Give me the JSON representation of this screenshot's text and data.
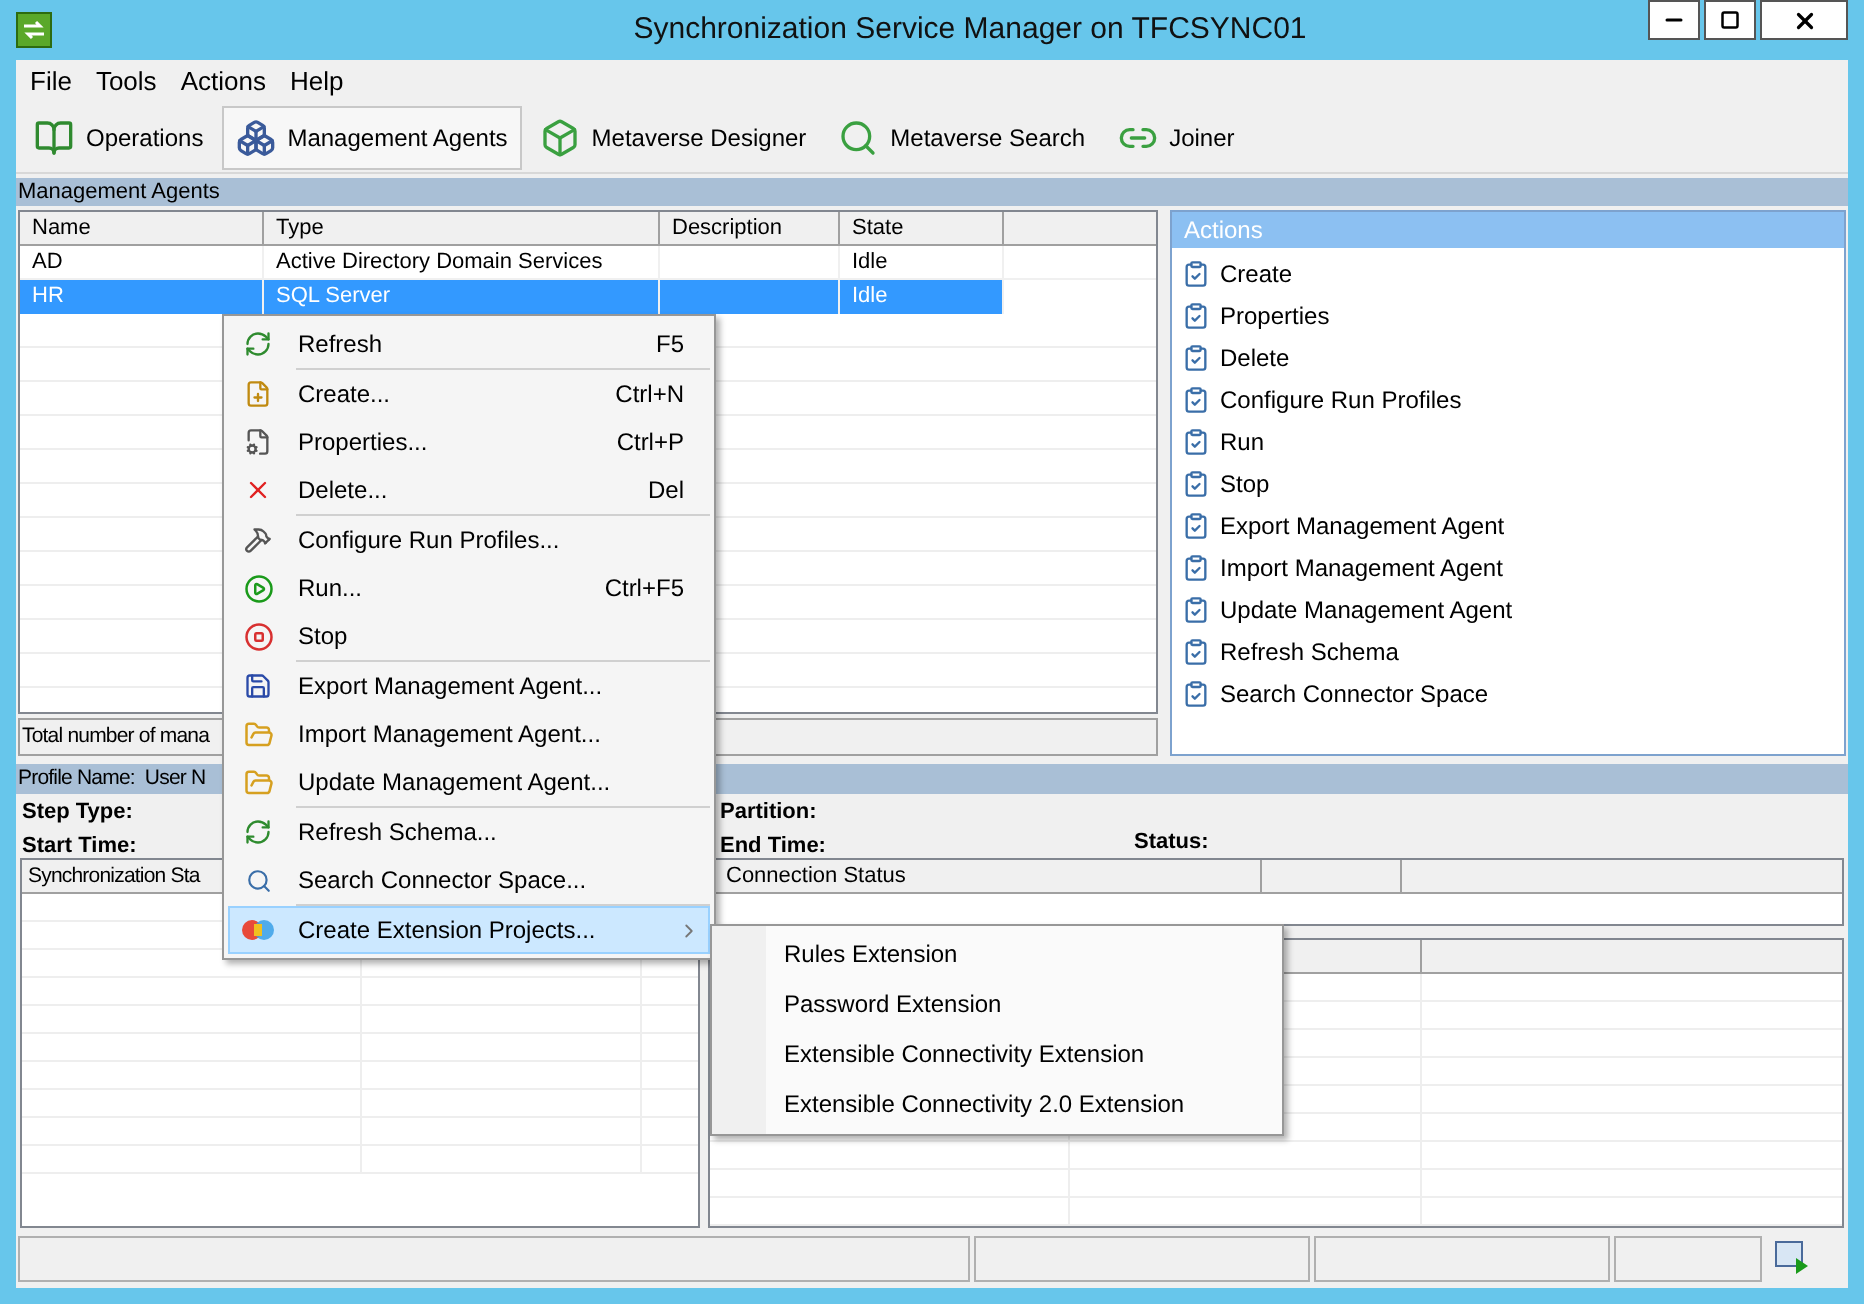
{
  "window": {
    "title": "Synchronization Service Manager on TFCSYNC01"
  },
  "menu_bar": [
    "File",
    "Tools",
    "Actions",
    "Help"
  ],
  "toolbar": [
    {
      "label": "Operations",
      "kind": "operations",
      "selected": false
    },
    {
      "label": "Management Agents",
      "kind": "agents",
      "selected": true
    },
    {
      "label": "Metaverse Designer",
      "kind": "designer",
      "selected": false
    },
    {
      "label": "Metaverse Search",
      "kind": "search",
      "selected": false
    },
    {
      "label": "Joiner",
      "kind": "joiner",
      "selected": false
    }
  ],
  "section_title": "Management Agents",
  "agents_table": {
    "columns": [
      "Name",
      "Type",
      "Description",
      "State"
    ],
    "rows": [
      {
        "cells": [
          "AD",
          "Active Directory Domain Services",
          "",
          "Idle"
        ],
        "selected": false
      },
      {
        "cells": [
          "HR",
          "SQL Server",
          "",
          "Idle"
        ],
        "selected": true
      }
    ]
  },
  "agents_status": "Total number of mana",
  "actions_panel": {
    "title": "Actions",
    "items": [
      "Create",
      "Properties",
      "Delete",
      "Configure Run Profiles",
      "Run",
      "Stop",
      "Export Management Agent",
      "Import Management Agent",
      "Update Management Agent",
      "Refresh Schema",
      "Search Connector Space"
    ]
  },
  "profile_bar": {
    "label": "Profile Name:",
    "value": "User N"
  },
  "run_details": {
    "step_type": "Step Type:",
    "start_time": "Start Time:",
    "partition": "Partition:",
    "end_time": "End Time:",
    "status": "Status:"
  },
  "sync_grid": {
    "header": "Synchronization Sta"
  },
  "connection_grid": {
    "header": "Connection Status"
  },
  "context_menu": [
    {
      "label": "Refresh",
      "shortcut": "F5",
      "kind": "refresh",
      "divider_after": true,
      "selected": false
    },
    {
      "label": "Create...",
      "shortcut": "Ctrl+N",
      "kind": "create",
      "divider_after": false,
      "selected": false
    },
    {
      "label": "Properties...",
      "shortcut": "Ctrl+P",
      "kind": "properties",
      "divider_after": false,
      "selected": false
    },
    {
      "label": "Delete...",
      "shortcut": "Del",
      "kind": "delete",
      "divider_after": true,
      "selected": false
    },
    {
      "label": "Configure Run Profiles...",
      "kind": "tools",
      "divider_after": false,
      "selected": false
    },
    {
      "label": "Run...",
      "shortcut": "Ctrl+F5",
      "kind": "run",
      "divider_after": false,
      "selected": false
    },
    {
      "label": "Stop",
      "kind": "stop",
      "divider_after": true,
      "selected": false
    },
    {
      "label": "Export Management Agent...",
      "kind": "save",
      "divider_after": false,
      "selected": false
    },
    {
      "label": "Import Management Agent...",
      "kind": "folder",
      "divider_after": false,
      "selected": false
    },
    {
      "label": "Update Management Agent...",
      "kind": "folder",
      "divider_after": true,
      "selected": false
    },
    {
      "label": "Refresh Schema...",
      "kind": "refresh",
      "divider_after": false,
      "selected": false
    },
    {
      "label": "Search Connector Space...",
      "kind": "search",
      "divider_after": true,
      "selected": false
    },
    {
      "label": "Create Extension Projects...",
      "kind": "extension",
      "divider_after": false,
      "selected": true,
      "submenu": true
    }
  ],
  "submenu": [
    "Rules Extension",
    "Password Extension",
    "Extensible Connectivity Extension",
    "Extensible Connectivity 2.0 Extension"
  ]
}
